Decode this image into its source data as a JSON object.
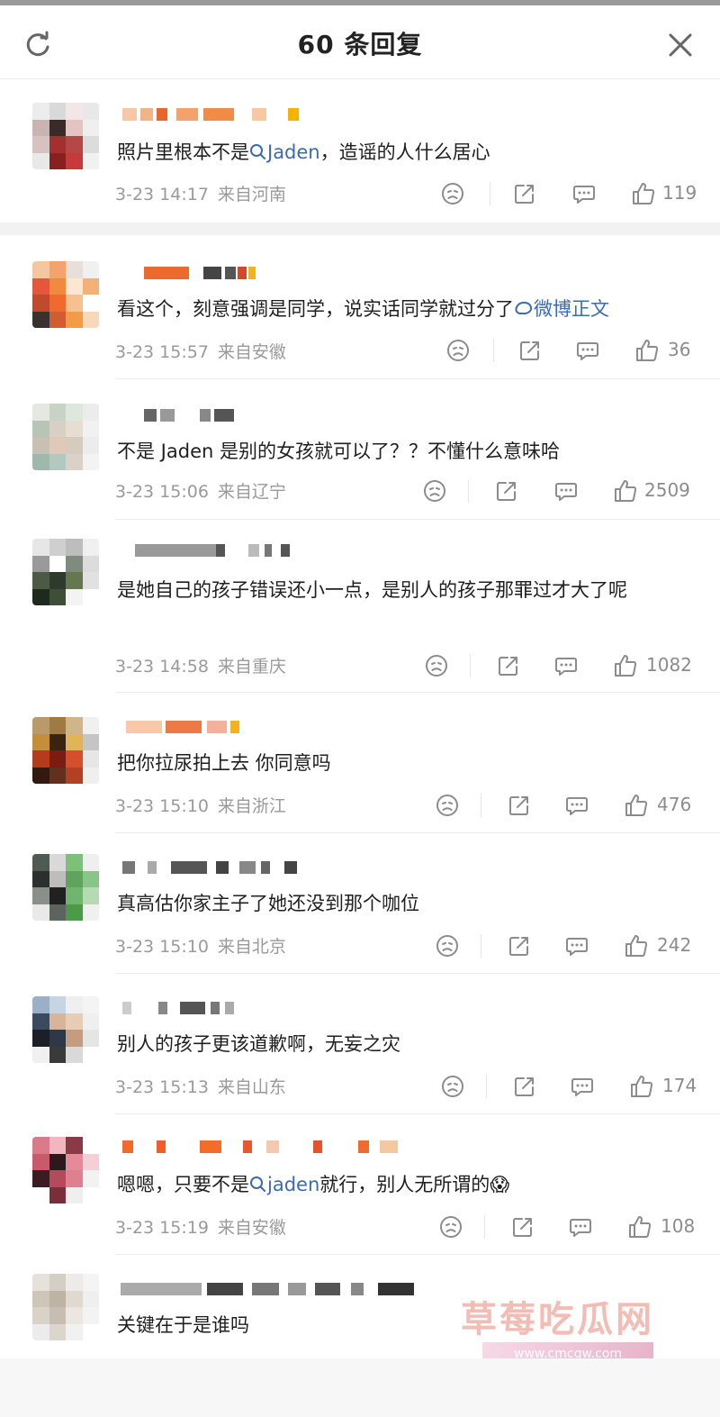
{
  "header": {
    "title": "60 条回复",
    "refresh_icon": "refresh-icon",
    "close_icon": "close-icon"
  },
  "colors": {
    "topic_link": "#3b6bb3",
    "meta_text": "#9a9a9a",
    "watermark": "#f2b2aa"
  },
  "comments": [
    {
      "pre": "照片里根本不是",
      "topic": "Jaden",
      "post": "，造谣的人什么居心",
      "time": "3-23 14:17",
      "location": "来自河南",
      "likes": "119"
    },
    {
      "pre": "看这个，刻意强调是同学，说实话同学就过分了",
      "topic": "微博正文",
      "post": "",
      "time": "3-23 15:57",
      "location": "来自安徽",
      "likes": "36"
    },
    {
      "pre": "不是 Jaden 是别的女孩就可以了？？不懂什么意味哈",
      "topic": "",
      "post": "",
      "time": "3-23 15:06",
      "location": "来自辽宁",
      "likes": "2509"
    },
    {
      "pre": "是她自己的孩子错误还小一点，是别人的孩子那罪过才大了呢",
      "topic": "",
      "post": "",
      "time": "3-23 14:58",
      "location": "来自重庆",
      "likes": "1082"
    },
    {
      "pre": "把你拉尿拍上去 你同意吗",
      "topic": "",
      "post": "",
      "time": "3-23 15:10",
      "location": "来自浙江",
      "likes": "476"
    },
    {
      "pre": "真高估你家主子了她还没到那个咖位",
      "topic": "",
      "post": "",
      "time": "3-23 15:10",
      "location": "来自北京",
      "likes": "242"
    },
    {
      "pre": "别人的孩子更该道歉啊，无妄之灾",
      "topic": "",
      "post": "",
      "time": "3-23 15:13",
      "location": "来自山东",
      "likes": "174"
    },
    {
      "pre": "嗯嗯，只要不是",
      "topic": "jaden",
      "post": "就行，别人无所谓的😱",
      "time": "3-23 15:19",
      "location": "来自安徽",
      "likes": "108"
    },
    {
      "pre": "关键在于是谁吗",
      "topic": "",
      "post": "",
      "time": "",
      "location": "",
      "likes": ""
    }
  ],
  "watermark": {
    "text": "草莓吃瓜网",
    "url": "www.cmcgw.com"
  }
}
